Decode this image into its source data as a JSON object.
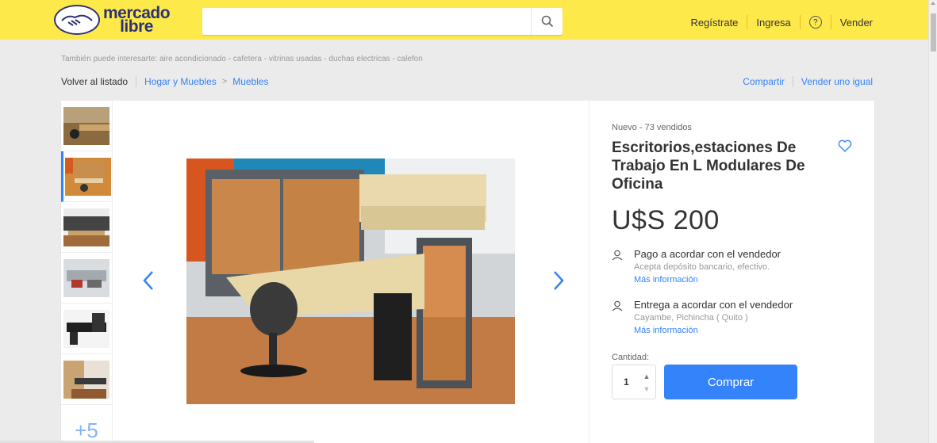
{
  "header": {
    "logo_line1": "mercado",
    "logo_line2": "libre",
    "search_placeholder": "",
    "search_icon": "search-icon",
    "nav": {
      "register": "Regístrate",
      "login": "Ingresa",
      "help": "?",
      "sell": "Vender"
    },
    "colors": {
      "background": "#fee94a",
      "brand": "#2d3277"
    }
  },
  "also_interest": "También puede interesarte: aire acondicionado - cafetera - vitrinas usadas - duchas electricas - calefon",
  "breadcrumb": {
    "back": "Volver al listado",
    "category": "Hogar y Muebles",
    "subcategory": "Muebles"
  },
  "actions": {
    "share": "Compartir",
    "sell_same": "Vender uno igual"
  },
  "gallery": {
    "thumbnail_count": 6,
    "more_label": "+5",
    "active_index": 1,
    "prev_icon": "chevron-left-icon",
    "next_icon": "chevron-right-icon"
  },
  "product": {
    "condition": "Nuevo  -  73 vendidos",
    "title": "Escritorios,estaciones De Trabajo En L Modulares De Oficina",
    "price": "U$S 200",
    "payment": {
      "title": "Pago a acordar con el vendedor",
      "detail": "Acepta depósito bancario, efectivo.",
      "link": "Más información"
    },
    "delivery": {
      "title": "Entrega a acordar con el vendedor",
      "detail": "Cayambe, Pichincha ( Quito )",
      "link": "Más información"
    },
    "quantity_label": "Cantidad:",
    "quantity": "1",
    "buy_label": "Comprar",
    "accent": "#3483fa"
  }
}
